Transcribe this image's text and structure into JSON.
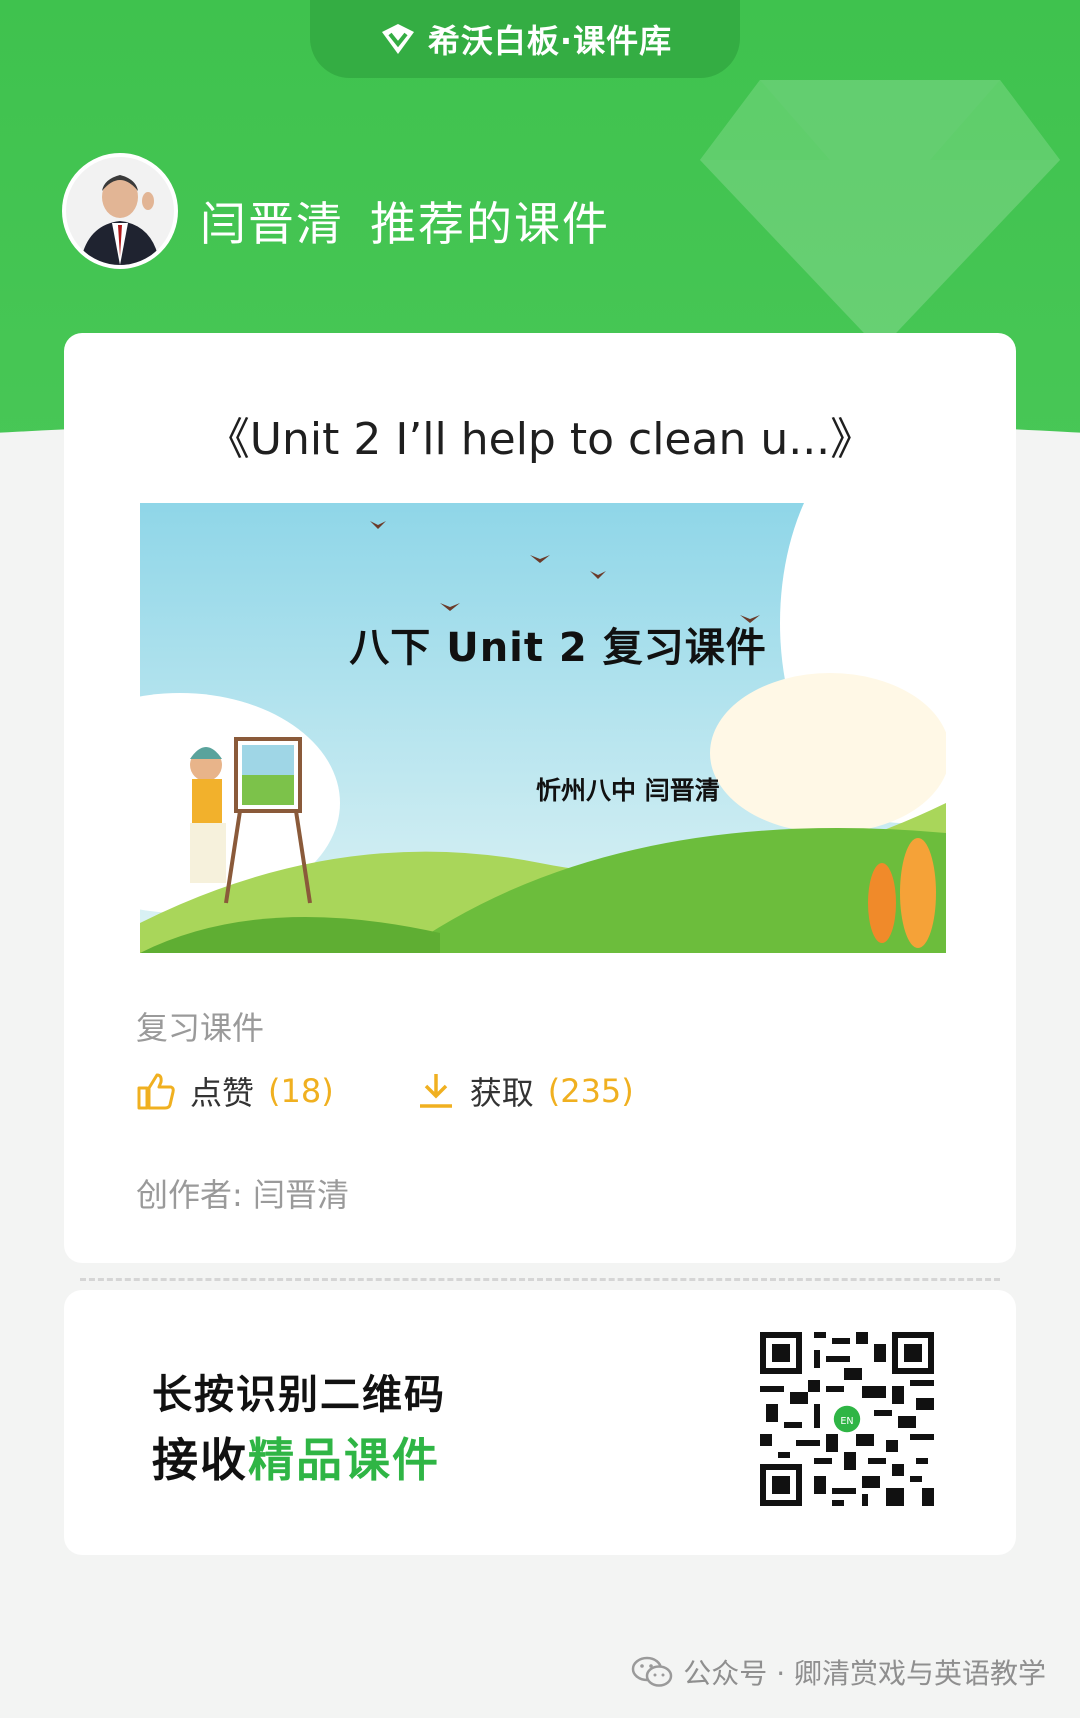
{
  "header": {
    "brand": "希沃白板·课件库",
    "author_name": "闫晋清",
    "recommend_suffix": "推荐的课件"
  },
  "card": {
    "title": "《Unit 2 I’ll help to clean u...》",
    "cover": {
      "title": "八下 Unit 2 复习课件",
      "subtitle": "忻州八中 闫晋清"
    },
    "tag": "复习课件",
    "like_label": "点赞",
    "like_count": "(18)",
    "get_label": "获取",
    "get_count": "(235)",
    "creator_label": "创作者:",
    "creator_name": "闫晋清"
  },
  "qr": {
    "line1": "长按识别二维码",
    "line2_prefix": "接收",
    "line2_highlight": "精品课件",
    "center_badge": "EN"
  },
  "footer": {
    "text": "公众号 · 卿清赏戏与英语教学"
  },
  "colors": {
    "brand_green": "#3fc24e",
    "accent_gold": "#f0b020",
    "highlight_green": "#2fb545"
  }
}
